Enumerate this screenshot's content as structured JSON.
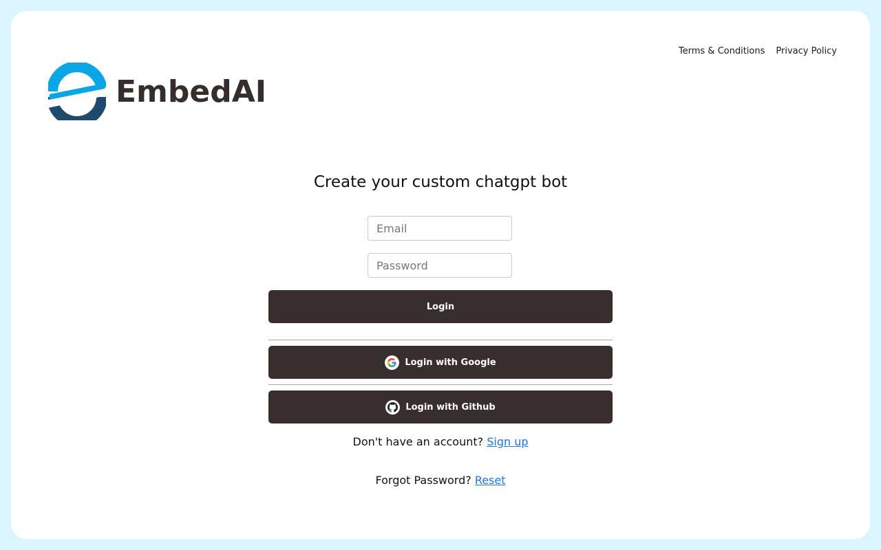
{
  "top_links": {
    "terms": "Terms & Conditions",
    "privacy": "Privacy Policy"
  },
  "logo": {
    "text": "EmbedAI",
    "icon": "embedai-logo-icon",
    "colors": {
      "light_blue": "#0aa6e6",
      "dark_blue": "#1d4a6e"
    }
  },
  "form": {
    "heading": "Create your custom chatgpt bot",
    "email_placeholder": "Email",
    "email_value": "",
    "password_placeholder": "Password",
    "password_value": "",
    "login_label": "Login",
    "google_label": "Login with Google",
    "google_icon": "google-icon",
    "github_label": "Login with Github",
    "github_icon": "github-icon"
  },
  "signup": {
    "prompt": "Don't have an account?",
    "link": "Sign up"
  },
  "forgot": {
    "prompt": "Forgot Password?",
    "link": "Reset"
  },
  "colors": {
    "page_background": "#dbf4ff",
    "button": "#372e2d",
    "link": "#1a73e8"
  }
}
